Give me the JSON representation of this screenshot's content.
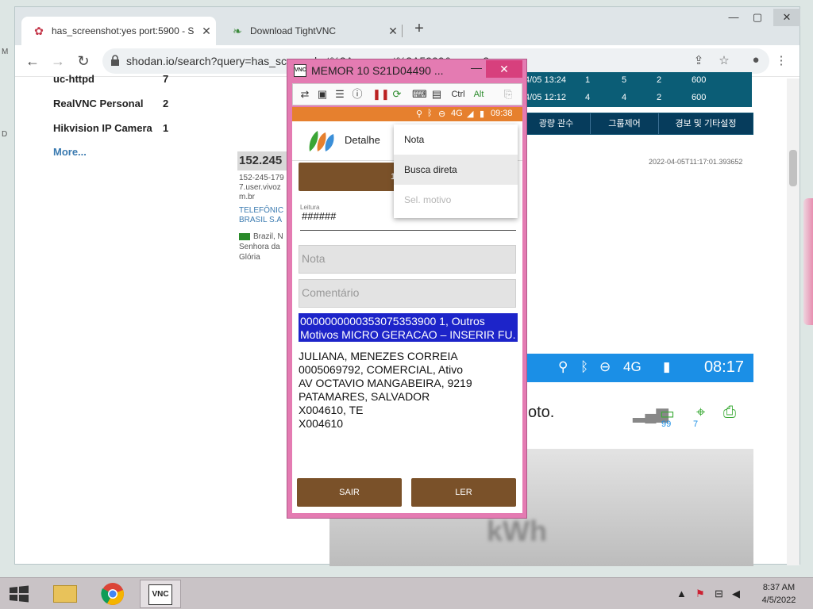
{
  "browser": {
    "tabs": [
      {
        "label": "has_screenshot:yes port:5900 - S",
        "icon": "shodan-icon",
        "active": true
      },
      {
        "label": "Download TightVNC",
        "icon": "tightvnc-leaf-icon",
        "active": false
      }
    ],
    "url": "shodan.io/search?query=has_screenshot%3Ayes+port%3A5900&page=2"
  },
  "page": {
    "facets": [
      {
        "name": "uc-httpd",
        "count": "7"
      },
      {
        "name": "RealVNC Personal",
        "count": "2"
      },
      {
        "name": "Hikvision IP Camera",
        "count": "1"
      }
    ],
    "more_label": "More...",
    "result": {
      "ip": "152.245",
      "hostname_lines": [
        "152-245-179",
        "7.user.vivoz",
        "m.br"
      ],
      "org_lines": [
        "TELEFÔNIC",
        "BRASIL S.A"
      ],
      "location_lines": [
        "Brazil, N",
        "Senhora da",
        "Glória"
      ],
      "timestamp": "2022-04-05T11:17:01.393652"
    }
  },
  "korean_panel": {
    "rows": [
      [
        "4/05 13:24",
        "1",
        "5",
        "2",
        "600"
      ],
      [
        "4/05 12:12",
        "4",
        "4",
        "2",
        "600"
      ]
    ],
    "tabs": [
      "광량 관수",
      "그룹제어",
      "경보 및 기타설정"
    ]
  },
  "background_android": {
    "time": "08:17",
    "network": "4G",
    "text_fragment": "oto.",
    "battery_level": "99",
    "location_count": "7",
    "kwh_label": "kWh"
  },
  "vnc": {
    "title": "MEMOR 10 S21D04490 ...",
    "toolbar_ctrl": "Ctrl",
    "toolbar_alt": "Alt",
    "phone": {
      "network": "4G",
      "time": "09:38",
      "header_title": "Detalhe",
      "top_button": "1216411",
      "input_label": "Leitura",
      "input_value": "######",
      "nota_placeholder": "Nota",
      "comentario_placeholder": "Comentário",
      "selected_lines": [
        "0000000000353075353900 1, Outros",
        "Motivos MICRO GERACAO – INSERIR FU..."
      ],
      "info_lines": [
        "JULIANA, MENEZES CORREIA",
        "0005069792, COMERCIAL, Ativo",
        "AV OCTAVIO MANGABEIRA, 9219",
        "PATAMARES, SALVADOR",
        "X004610, TE",
        "X004610"
      ],
      "menu": [
        "Nota",
        "Busca direta",
        "Sel. motivo"
      ],
      "button_sair": "SAIR",
      "button_ler": "LER"
    }
  },
  "taskbar": {
    "time": "8:37 AM",
    "date": "4/5/2022",
    "apps": [
      "file-explorer-icon",
      "chrome-icon",
      "vnc-viewer-icon"
    ]
  },
  "colors": {
    "vnc_frame": "#e47bb2",
    "phone_status": "#e6802e",
    "button_brown": "#7a5129",
    "selected_blue": "#1d24c9",
    "korean_table": "#0b5d76"
  }
}
